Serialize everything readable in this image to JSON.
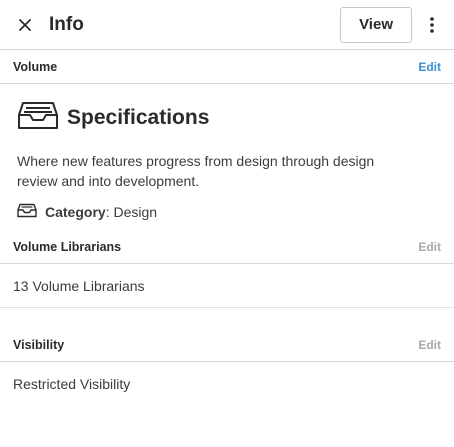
{
  "header": {
    "title": "Info",
    "view_label": "View"
  },
  "volume": {
    "section_label": "Volume",
    "edit_label": "Edit",
    "title": "Specifications",
    "description": "Where new features progress from design through design review and into development.",
    "category_key": "Category",
    "category_sep": ":",
    "category_value": "Design"
  },
  "librarians": {
    "section_label": "Volume Librarians",
    "edit_label": "Edit",
    "value": "13 Volume Librarians"
  },
  "visibility": {
    "section_label": "Visibility",
    "edit_label": "Edit",
    "value": "Restricted Visibility"
  },
  "colors": {
    "edit_active": "#3d8fd6",
    "edit_muted": "#a9a9a9",
    "text": "#2b2b2b",
    "divider": "#d8d8d8"
  },
  "icons": {
    "close": "close-icon",
    "more": "more-vertical-icon",
    "volume": "inbox-tray-icon",
    "category": "category-tray-icon"
  }
}
